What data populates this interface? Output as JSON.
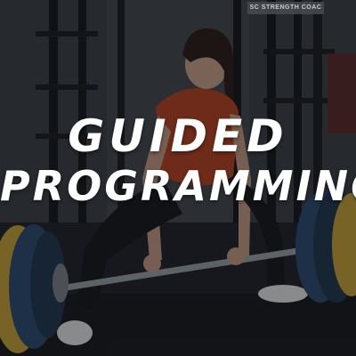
{
  "image": {
    "headline_line1": "GUIDED",
    "headline_line2": "PROGRAMMING",
    "wall_sign": "SC  STRENGTH COAC",
    "colors": {
      "overlay": "#0a0c10",
      "text": "#ffffff",
      "shirt": "#b8431f",
      "plate_yellow": "#c9a238",
      "plate_blue": "#2d4a6e"
    }
  }
}
